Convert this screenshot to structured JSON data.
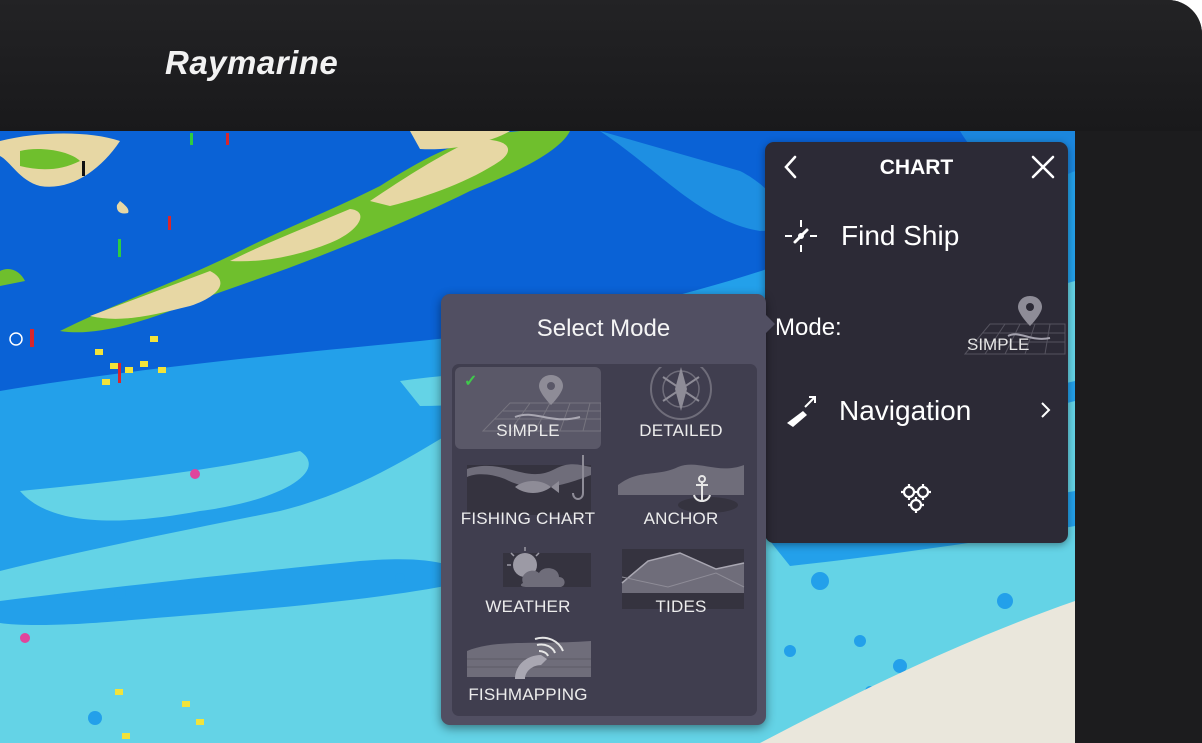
{
  "brand": {
    "logo_text": "Raymarine"
  },
  "chart_panel": {
    "title": "CHART",
    "back_icon": "chevron-left-icon",
    "close_icon": "close-icon",
    "items": {
      "find_ship": {
        "label": "Find Ship",
        "icon": "find-ship-icon"
      },
      "mode": {
        "label": "Mode:",
        "value": "SIMPLE",
        "icon": "simple-mode-thumbnail"
      },
      "navigation": {
        "label": "Navigation",
        "icon": "navigation-icon"
      },
      "settings": {
        "icon": "settings-gears-icon"
      }
    }
  },
  "select_mode": {
    "title": "Select Mode",
    "selected": "SIMPLE",
    "options": [
      {
        "label": "SIMPLE",
        "selected": true
      },
      {
        "label": "DETAILED",
        "selected": false
      },
      {
        "label": "FISHING CHART",
        "selected": false
      },
      {
        "label": "ANCHOR",
        "selected": false
      },
      {
        "label": "WEATHER",
        "selected": false
      },
      {
        "label": "TIDES",
        "selected": false
      },
      {
        "label": "FISHMAPPING",
        "selected": false
      }
    ]
  },
  "colors": {
    "panel_bg": "#2c2a36",
    "popup_bg": "#514f62",
    "deep_water": "#0a62d6",
    "mid_water": "#22a3e8",
    "shallow_water": "#6dd6e6",
    "land": "#e7d7a4",
    "vegetation": "#6fbf2d",
    "beach": "#eae7dc",
    "check": "#3fc94b"
  }
}
